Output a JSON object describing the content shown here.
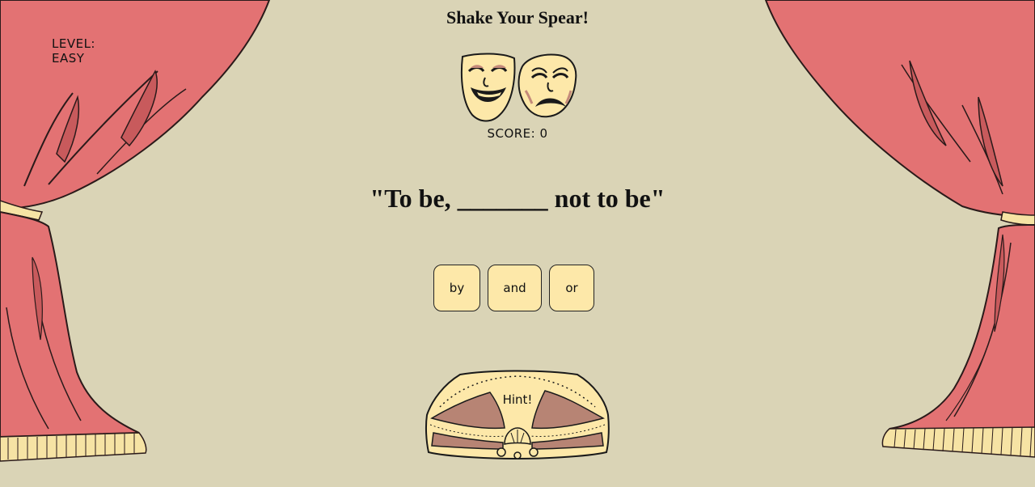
{
  "game": {
    "title": "Shake Your Spear!",
    "level_label": "LEVEL:",
    "level_value": "EASY",
    "score_text": "SCORE: 0",
    "score": 0
  },
  "question": {
    "quote": "\"To be, _______ not to be\""
  },
  "choices": [
    "by",
    "and",
    "or"
  ],
  "hint": {
    "label": "Hint!"
  },
  "colors": {
    "background": "#dad4b6",
    "curtain": "#e37273",
    "curtain_shadow": "#c85a5c",
    "fringe": "#f6e3a4",
    "button": "#fde8a9",
    "hint_inner": "#b78474"
  },
  "icons": [
    "comedy-mask-icon",
    "tragedy-mask-icon"
  ]
}
